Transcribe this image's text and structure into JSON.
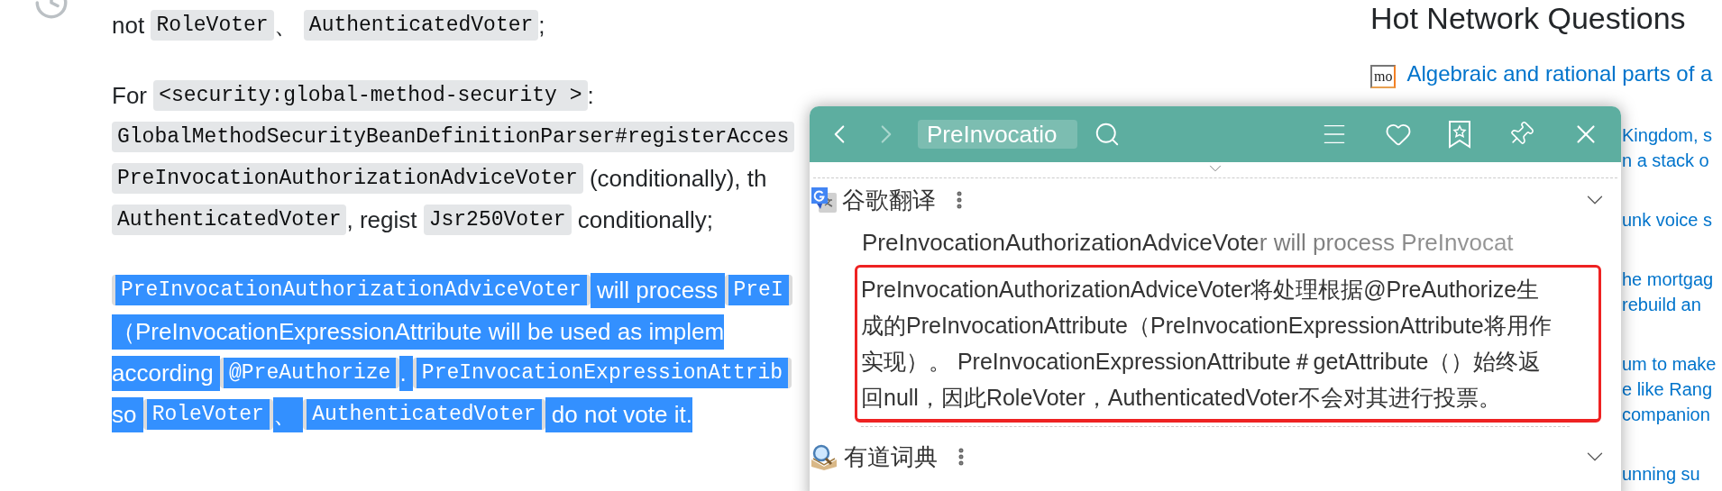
{
  "article": {
    "paragraphs": [
      {
        "selected": false,
        "lines": [
          [
            {
              "kind": "text",
              "text": "not "
            },
            {
              "kind": "code",
              "text": "RoleVoter"
            },
            {
              "kind": "text",
              "text": "、 "
            },
            {
              "kind": "code",
              "text": "AuthenticatedVoter"
            },
            {
              "kind": "text",
              "text": ";"
            }
          ]
        ]
      },
      {
        "selected": false,
        "lines": [
          [
            {
              "kind": "text",
              "text": "For "
            },
            {
              "kind": "code",
              "text": "<security:global-method-security >"
            },
            {
              "kind": "text",
              "text": ":"
            }
          ],
          [
            {
              "kind": "code",
              "text": "GlobalMethodSecurityBeanDefinitionParser#registerAcces"
            }
          ],
          [
            {
              "kind": "code",
              "text": "PreInvocationAuthorizationAdviceVoter"
            },
            {
              "kind": "text",
              "text": " (conditionally), th"
            }
          ],
          [
            {
              "kind": "code",
              "text": "AuthenticatedVoter"
            },
            {
              "kind": "text",
              "text": ", regist "
            },
            {
              "kind": "code",
              "text": "Jsr250Voter"
            },
            {
              "kind": "text",
              "text": " conditionally;"
            }
          ]
        ]
      },
      {
        "selected": true,
        "lines": [
          [
            {
              "kind": "code",
              "text": "PreInvocationAuthorizationAdviceVoter"
            },
            {
              "kind": "text",
              "text": " will process "
            },
            {
              "kind": "code",
              "text": "PreI"
            }
          ],
          [
            {
              "kind": "text",
              "text": "（PreInvocationExpressionAttribute will be used as implem"
            }
          ],
          [
            {
              "kind": "text",
              "text": "according "
            },
            {
              "kind": "code",
              "text": "@PreAuthorize"
            },
            {
              "kind": "text",
              "text": ". "
            },
            {
              "kind": "code",
              "text": "PreInvocationExpressionAttrib"
            }
          ],
          [
            {
              "kind": "text",
              "text": "so "
            },
            {
              "kind": "code",
              "text": "RoleVoter"
            },
            {
              "kind": "text",
              "text": "、 "
            },
            {
              "kind": "code",
              "text": "AuthenticatedVoter"
            },
            {
              "kind": "text",
              "text": " do not vote it."
            }
          ]
        ]
      }
    ]
  },
  "sidebar": {
    "title": "Hot Network Questions",
    "questions": [
      {
        "site_icon": "mo",
        "lines": [
          "Algebraic and rational parts of a"
        ]
      },
      {
        "lines": [
          "Kingdom, s",
          "n a stack o"
        ]
      },
      {
        "lines": [
          "unk voice s"
        ]
      },
      {
        "lines": [
          "he mortgag",
          "rebuild an"
        ]
      },
      {
        "lines": [
          "um to make",
          "e like Rang",
          "companion"
        ]
      },
      {
        "lines": [
          "unning su"
        ]
      }
    ]
  },
  "popup": {
    "search": {
      "value": "PreInvocatio"
    },
    "sections": [
      {
        "kind": "translation",
        "name": "谷歌翻译",
        "source": "PreInvocationAuthorizationAdviceVoter will process PreInvocat",
        "translation": [
          "PreInvocationAuthorizationAdviceVoter将处理根据@PreAuthorize生",
          "成的PreInvocationAttribute（PreInvocationExpressionAttribute将用作",
          "实现）。 PreInvocationExpressionAttribute＃getAttribute（）始终返",
          "回null，因此RoleVoter，AuthenticatedVoter不会对其进行投票。"
        ]
      },
      {
        "kind": "dictionary",
        "name": "有道词典"
      }
    ]
  }
}
